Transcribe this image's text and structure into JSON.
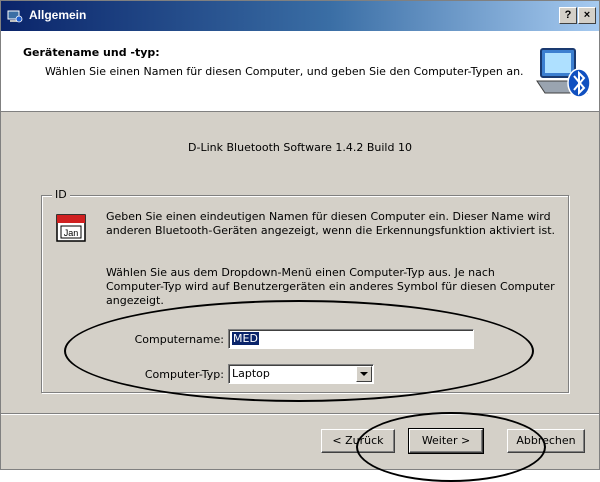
{
  "window": {
    "title": "Allgemein",
    "help_label": "?",
    "close_label": "×"
  },
  "header": {
    "title": "Gerätename und -typ:",
    "subtitle": "Wählen Sie einen Namen für diesen Computer, und geben Sie den Computer-Typen an."
  },
  "version": "D-Link Bluetooth Software 1.4.2 Build 10",
  "group": {
    "legend": "ID",
    "calendar_label": "Jan",
    "description1": "Geben Sie einen eindeutigen Namen für diesen Computer ein. Dieser Name wird anderen Bluetooth-Geräten angezeigt, wenn die Erkennungsfunktion aktiviert ist.",
    "description2": "Wählen Sie aus dem Dropdown-Menü einen Computer-Typ aus. Je nach Computer-Typ wird auf Benutzergeräten ein anderes Symbol für diesen Computer angezeigt."
  },
  "form": {
    "name_label": "Computername:",
    "name_value": "MED",
    "type_label": "Computer-Typ:",
    "type_value": "Laptop"
  },
  "buttons": {
    "back": "< Zurück",
    "next": "Weiter >",
    "cancel": "Abbrechen"
  },
  "colors": {
    "titlebar": "#0a246a",
    "face": "#d4d0c8",
    "selection": "#0a246a"
  }
}
